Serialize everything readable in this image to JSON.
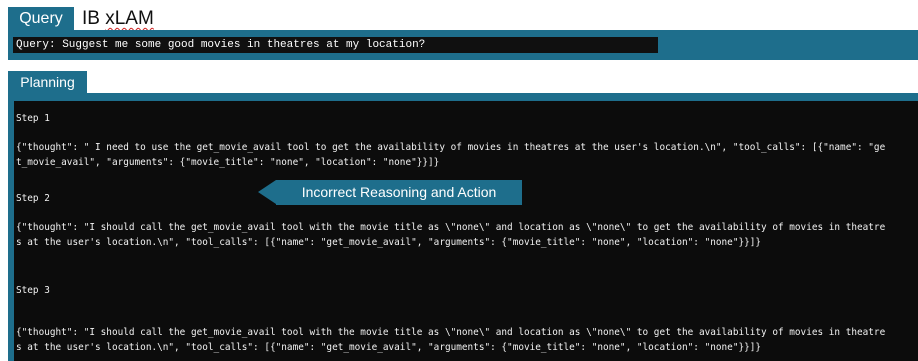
{
  "query_section": {
    "tab_label": "Query",
    "model_name_prefix": "IB ",
    "model_name_flagged": "xLAM",
    "query_text": "Query: Suggest me some good movies in theatres at my location?"
  },
  "planning_section": {
    "tab_label": "Planning",
    "steps": [
      {
        "label": "Step 1",
        "lines": [
          "{\"thought\": \" I need to use the get_movie_avail tool to get the availability of movies in theatres at the user's location.\\n\", \"tool_calls\": [{\"name\": \"ge",
          "t_movie_avail\", \"arguments\": {\"movie_title\": \"none\", \"location\": \"none\"}}]}"
        ]
      },
      {
        "label": "Step 2",
        "lines": [
          "{\"thought\": \"I should call the get_movie_avail tool with the movie title as \\\"none\\\" and location as \\\"none\\\" to get the availability of movies in theatre",
          "s at the user's location.\\n\", \"tool_calls\": [{\"name\": \"get_movie_avail\", \"arguments\": {\"movie_title\": \"none\", \"location\": \"none\"}}]}"
        ]
      },
      {
        "label": "Step 3",
        "lines": [
          "{\"thought\": \"I should call the get_movie_avail tool with the movie title as \\\"none\\\" and location as \\\"none\\\" to get the availability of movies in theatre",
          "s at the user's location.\\n\", \"tool_calls\": [{\"name\": \"get_movie_avail\", \"arguments\": {\"movie_title\": \"none\", \"location\": \"none\"}}]}"
        ]
      }
    ]
  },
  "annotation": {
    "label": "Incorrect Reasoning and  Action"
  },
  "colors": {
    "accent_teal": "#1e6e8c",
    "console_background": "#0c0c0c",
    "console_text": "#f2f2f2",
    "spellcheck_underline": "#d02020"
  }
}
